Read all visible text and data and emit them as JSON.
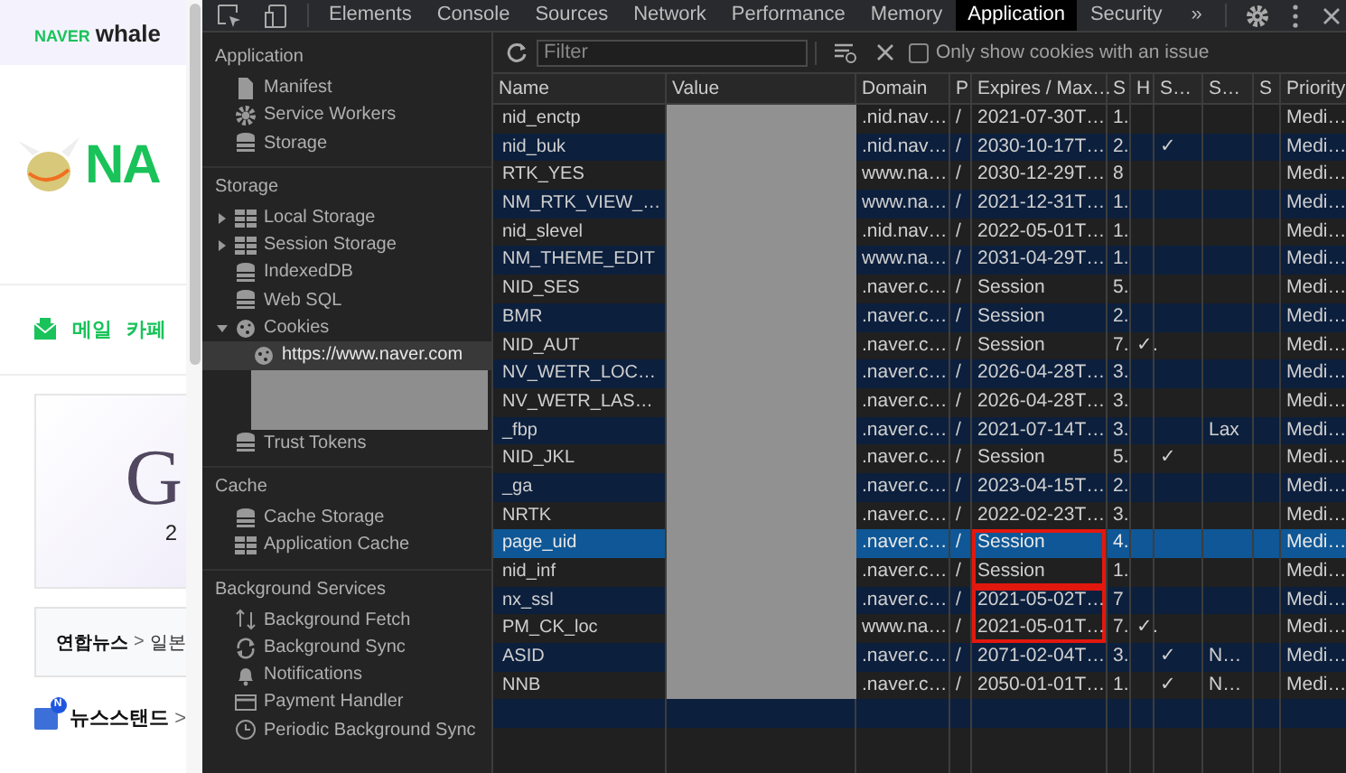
{
  "webpage": {
    "brand": {
      "naver": "NAVER",
      "whale": "whale"
    },
    "logo_text": "NA",
    "shortcuts": [
      "메일",
      "카페"
    ],
    "banner": {
      "letter": "G",
      "sub": "2"
    },
    "news": {
      "source": "연합뉴스",
      "arrow": ">",
      "headline": "일본"
    },
    "newsstand": {
      "badge": "N",
      "label": "뉴스스탠드",
      "arrow": ">"
    }
  },
  "devtools": {
    "tabs": [
      {
        "label": "Elements",
        "selected": false
      },
      {
        "label": "Console",
        "selected": false
      },
      {
        "label": "Sources",
        "selected": false
      },
      {
        "label": "Network",
        "selected": false
      },
      {
        "label": "Performance",
        "selected": false
      },
      {
        "label": "Memory",
        "selected": false
      },
      {
        "label": "Application",
        "selected": true
      },
      {
        "label": "Security",
        "selected": false
      }
    ],
    "more_tabs": "»",
    "sidebar": [
      {
        "title": "Application",
        "items": [
          {
            "label": "Manifest",
            "kind": "file"
          },
          {
            "label": "Service Workers",
            "kind": "gear"
          },
          {
            "label": "Storage",
            "kind": "db"
          }
        ]
      },
      {
        "title": "Storage",
        "items": [
          {
            "label": "Local Storage",
            "kind": "grid",
            "expanded": false
          },
          {
            "label": "Session Storage",
            "kind": "grid",
            "expanded": false
          },
          {
            "label": "IndexedDB",
            "kind": "db"
          },
          {
            "label": "Web SQL",
            "kind": "db"
          },
          {
            "label": "Cookies",
            "kind": "cookie",
            "expanded": true,
            "children": [
              {
                "label": "https://www.naver.com",
                "kind": "cookie",
                "selected": true
              },
              {
                "kind": "redacted"
              }
            ]
          },
          {
            "label": "Trust Tokens",
            "kind": "db"
          }
        ]
      },
      {
        "title": "Cache",
        "items": [
          {
            "label": "Cache Storage",
            "kind": "db"
          },
          {
            "label": "Application Cache",
            "kind": "grid"
          }
        ]
      },
      {
        "title": "Background Services",
        "items": [
          {
            "label": "Background Fetch",
            "kind": "updown"
          },
          {
            "label": "Background Sync",
            "kind": "sync"
          },
          {
            "label": "Notifications",
            "kind": "bell"
          },
          {
            "label": "Payment Handler",
            "kind": "card"
          },
          {
            "label": "Periodic Background Sync",
            "kind": "clock"
          }
        ]
      }
    ],
    "toolbar": {
      "filter_placeholder": "Filter",
      "only_issues": {
        "label": "Only show cookies with an issue",
        "checked": false
      }
    },
    "table": {
      "columns": [
        "Name",
        "Value",
        "Domain",
        "P",
        "Expires / Max…",
        "S",
        "H",
        "S…",
        "S…",
        "S",
        "Priority"
      ],
      "rows": [
        {
          "name": "nid_enctp",
          "domain": ".nid.nav…",
          "path": "/",
          "expires": "2021-07-30T…",
          "size": "1.",
          "priority": "Medi…",
          "selected": false
        },
        {
          "name": "nid_buk",
          "domain": ".nid.nav…",
          "path": "/",
          "expires": "2030-10-17T…",
          "size": "2.",
          "secure": "✓",
          "priority": "Medi…",
          "selected": false
        },
        {
          "name": "RTK_YES",
          "domain": "www.na…",
          "path": "/",
          "expires": "2030-12-29T…",
          "size": "8",
          "priority": "Medi…",
          "selected": false
        },
        {
          "name": "NM_RTK_VIEW_…",
          "domain": "www.na…",
          "path": "/",
          "expires": "2021-12-31T…",
          "size": "1.",
          "priority": "Medi…",
          "selected": false
        },
        {
          "name": "nid_slevel",
          "domain": ".nid.nav…",
          "path": "/",
          "expires": "2022-05-01T…",
          "size": "1.",
          "priority": "Medi…",
          "selected": false
        },
        {
          "name": "NM_THEME_EDIT",
          "domain": "www.na…",
          "path": "/",
          "expires": "2031-04-29T…",
          "size": "1.",
          "priority": "Medi…",
          "selected": false
        },
        {
          "name": "NID_SES",
          "domain": ".naver.c…",
          "path": "/",
          "expires": "Session",
          "size": "5.",
          "priority": "Medi…",
          "selected": false
        },
        {
          "name": "BMR",
          "domain": ".naver.c…",
          "path": "/",
          "expires": "Session",
          "size": "2.",
          "priority": "Medi…",
          "selected": false
        },
        {
          "name": "NID_AUT",
          "domain": ".naver.c…",
          "path": "/",
          "expires": "Session",
          "size": "7.",
          "http_only": "✓.",
          "priority": "Medi…",
          "selected": false
        },
        {
          "name": "NV_WETR_LOC…",
          "domain": ".naver.c…",
          "path": "/",
          "expires": "2026-04-28T…",
          "size": "3.",
          "priority": "Medi…",
          "selected": false
        },
        {
          "name": "NV_WETR_LAS…",
          "domain": ".naver.c…",
          "path": "/",
          "expires": "2026-04-28T…",
          "size": "3.",
          "priority": "Medi…",
          "selected": false
        },
        {
          "name": "_fbp",
          "domain": ".naver.c…",
          "path": "/",
          "expires": "2021-07-14T…",
          "size": "3.",
          "same_site": "Lax",
          "priority": "Medi…",
          "selected": false
        },
        {
          "name": "NID_JKL",
          "domain": ".naver.c…",
          "path": "/",
          "expires": "Session",
          "size": "5.",
          "secure": "✓",
          "priority": "Medi…",
          "selected": false
        },
        {
          "name": "_ga",
          "domain": ".naver.c…",
          "path": "/",
          "expires": "2023-04-15T…",
          "size": "2.",
          "priority": "Medi…",
          "selected": false
        },
        {
          "name": "NRTK",
          "domain": ".naver.c…",
          "path": "/",
          "expires": "2022-02-23T…",
          "size": "3.",
          "priority": "Medi…",
          "selected": false
        },
        {
          "name": "page_uid",
          "domain": ".naver.c…",
          "path": "/",
          "expires": "Session",
          "size": "4.",
          "priority": "Medi…",
          "selected": true,
          "boxed": true,
          "box_start": true
        },
        {
          "name": "nid_inf",
          "domain": ".naver.c…",
          "path": "/",
          "expires": "Session",
          "size": "1.",
          "priority": "Medi…",
          "selected": false,
          "boxed": true
        },
        {
          "name": "nx_ssl",
          "domain": ".naver.c…",
          "path": "/",
          "expires": "2021-05-02T…",
          "size": "7",
          "priority": "Medi…",
          "selected": false,
          "boxed": true,
          "box_start": true
        },
        {
          "name": "PM_CK_loc",
          "domain": "www.na…",
          "path": "/",
          "expires": "2021-05-01T…",
          "size": "7.",
          "http_only": "✓.",
          "priority": "Medi…",
          "selected": false,
          "boxed": true
        },
        {
          "name": "ASID",
          "domain": ".naver.c…",
          "path": "/",
          "expires": "2071-02-04T…",
          "size": "3.",
          "secure": "✓",
          "same_site": "N…",
          "priority": "Medi…",
          "selected": false
        },
        {
          "name": "NNB",
          "domain": ".naver.c…",
          "path": "/",
          "expires": "2050-01-01T…",
          "size": "1.",
          "secure": "✓",
          "same_site": "N…",
          "priority": "Medi…",
          "selected": false
        }
      ]
    }
  }
}
